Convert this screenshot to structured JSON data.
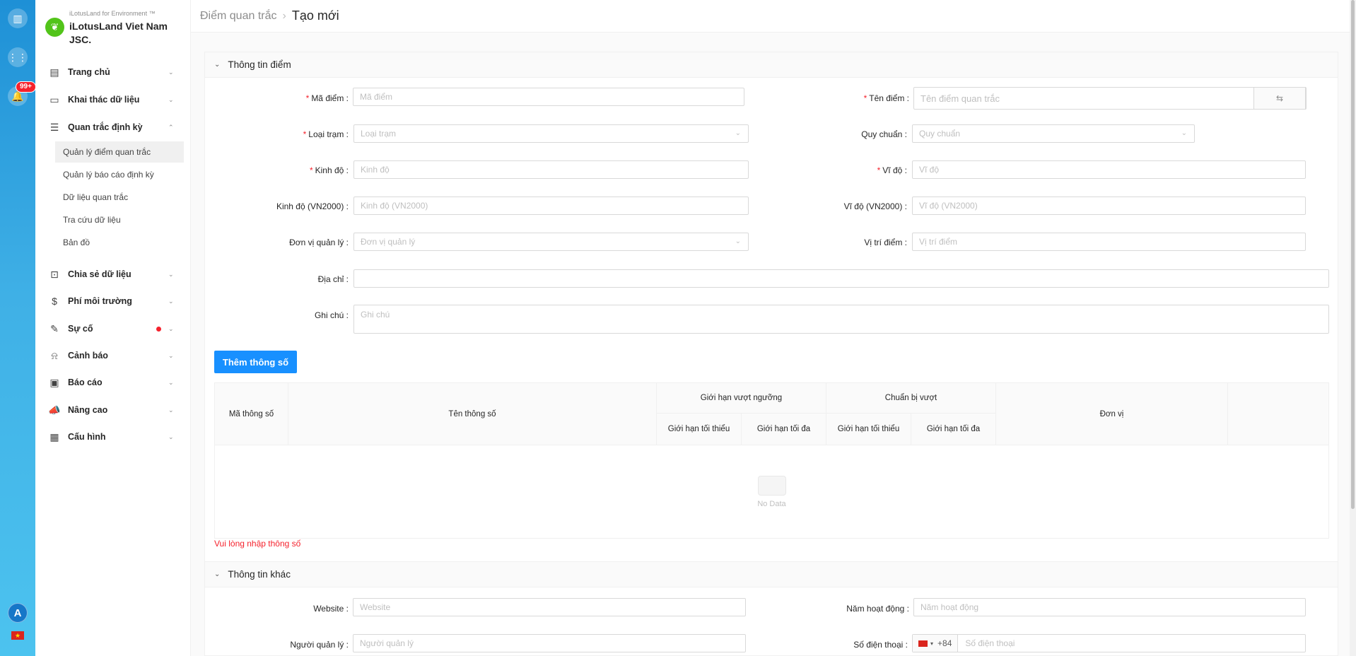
{
  "rail": {
    "badge": "99+",
    "avatar": "A"
  },
  "brand": {
    "small": "iLotusLand for Environment ™",
    "name": "iLotusLand Viet Nam JSC."
  },
  "menu": [
    {
      "label": "Trang chủ",
      "icon": "home-icon"
    },
    {
      "label": "Khai thác dữ liệu",
      "icon": "monitor-icon"
    },
    {
      "label": "Quan trắc định kỳ",
      "icon": "list-icon"
    },
    {
      "label": "Chia sẻ dữ liệu",
      "icon": "share-icon"
    },
    {
      "label": "Phí môi trường",
      "icon": "dollar-icon"
    },
    {
      "label": "Sự cố",
      "icon": "edit-icon"
    },
    {
      "label": "Cảnh báo",
      "icon": "bell-icon"
    },
    {
      "label": "Báo cáo",
      "icon": "report-icon"
    },
    {
      "label": "Nâng cao",
      "icon": "megaphone-icon"
    },
    {
      "label": "Cấu hình",
      "icon": "settings-icon"
    }
  ],
  "submenu": [
    "Quản lý điểm quan trắc",
    "Quản lý báo cáo định kỳ",
    "Dữ liệu quan trắc",
    "Tra cứu dữ liệu",
    "Bản đồ"
  ],
  "breadcrumb": {
    "parent": "Điểm quan trắc",
    "current": "Tạo mới"
  },
  "section1": {
    "title": "Thông tin điểm",
    "ma_diem": {
      "label": "Mã điểm",
      "placeholder": "Mã điểm"
    },
    "ten_diem": {
      "label": "Tên điểm",
      "placeholder": "Tên điểm quan trắc"
    },
    "loai_tram": {
      "label": "Loại trạm",
      "placeholder": "Loại trạm"
    },
    "quy_chuan": {
      "label": "Quy chuẩn",
      "placeholder": "Quy chuẩn"
    },
    "kinh_do": {
      "label": "Kinh độ",
      "placeholder": "Kinh độ"
    },
    "vi_do": {
      "label": "Vĩ độ",
      "placeholder": "Vĩ độ"
    },
    "kinh_do_vn": {
      "label": "Kinh độ (VN2000)",
      "placeholder": "Kinh độ (VN2000)"
    },
    "vi_do_vn": {
      "label": "Vĩ độ (VN2000)",
      "placeholder": "Vĩ độ (VN2000)"
    },
    "don_vi": {
      "label": "Đơn vị quản lý",
      "placeholder": "Đơn vị quản lý"
    },
    "vi_tri": {
      "label": "Vị trí điểm",
      "placeholder": "Vị trí điểm"
    },
    "dia_chi": {
      "label": "Địa chỉ",
      "placeholder": ""
    },
    "ghi_chu": {
      "label": "Ghi chú",
      "placeholder": "Ghi chú"
    }
  },
  "add_button": "Thêm thông số",
  "table": {
    "col_code": "Mã thông số",
    "col_name": "Tên thông số",
    "group1": "Giới hạn vượt ngưỡng",
    "group2": "Chuẩn bị vượt",
    "min": "Giới hạn tối thiểu",
    "max": "Giới hạn tối đa",
    "unit": "Đơn vị",
    "empty": "No Data"
  },
  "error": "Vui lòng nhập thông số",
  "section2": {
    "title": "Thông tin khác",
    "website": {
      "label": "Website",
      "placeholder": "Website"
    },
    "nam": {
      "label": "Năm hoạt động",
      "placeholder": "Năm hoạt động"
    },
    "nguoi": {
      "label": "Người quản lý",
      "placeholder": "Người quản lý"
    },
    "sdt": {
      "label": "Số điện thoại",
      "placeholder": "Số điện thoại",
      "prefix": "+84"
    }
  }
}
